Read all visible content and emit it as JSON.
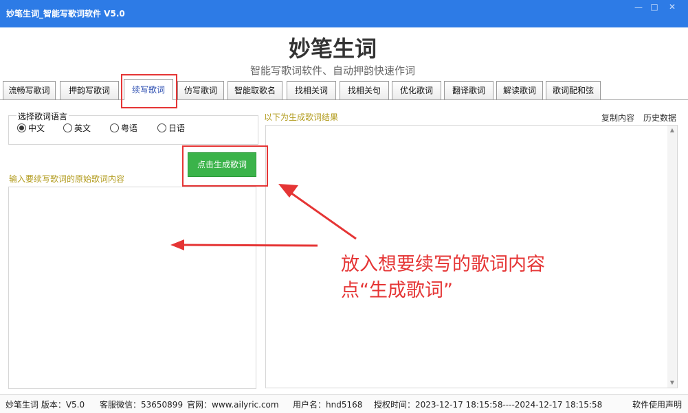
{
  "window": {
    "title": "妙笔生词_智能写歌词软件 V5.0",
    "controls": {
      "minimize": "—",
      "maximize": "□",
      "close": "✕"
    }
  },
  "header": {
    "app_name": "妙笔生词",
    "subtitle": "智能写歌词软件、自动押韵快速作词"
  },
  "tabs": [
    {
      "label": "流畅写歌词"
    },
    {
      "label": "押韵写歌词"
    },
    {
      "label": "续写歌词",
      "active": true
    },
    {
      "label": "仿写歌词"
    },
    {
      "label": "智能取歌名"
    },
    {
      "label": "找相关词"
    },
    {
      "label": "找相关句"
    },
    {
      "label": "优化歌词"
    },
    {
      "label": "翻译歌词"
    },
    {
      "label": "解读歌词"
    },
    {
      "label": "歌词配和弦"
    }
  ],
  "language": {
    "group_title": "选择歌词语言",
    "options": [
      {
        "label": "中文",
        "selected": true
      },
      {
        "label": "英文",
        "selected": false
      },
      {
        "label": "粤语",
        "selected": false
      },
      {
        "label": "日语",
        "selected": false
      }
    ]
  },
  "generate_button": "点击生成歌词",
  "input": {
    "label": "输入要续写歌词的原始歌词内容",
    "value": ""
  },
  "result": {
    "label": "以下为生成歌词结果",
    "copy_link": "复制内容",
    "history_link": "历史数据",
    "value": ""
  },
  "annotation": {
    "line1": "放入想要续写的歌词内容",
    "line2": "点“生成歌词”",
    "color": "#e53535"
  },
  "statusbar": {
    "version": "妙笔生词 版本：V5.0",
    "wechat": "客服微信：53650899",
    "website": "官网：www.ailyric.com",
    "username": "用户名：hnd5168",
    "license": "授权时间：2023-12-17 18:15:58----2024-12-17 18:15:58",
    "disclaimer": "软件使用声明"
  },
  "colors": {
    "titlebar": "#2d7be6",
    "generate_button": "#3bb34a",
    "label_gold": "#b29b1c",
    "highlight_red": "#e53535",
    "active_tab_text": "#2a4cb0"
  }
}
